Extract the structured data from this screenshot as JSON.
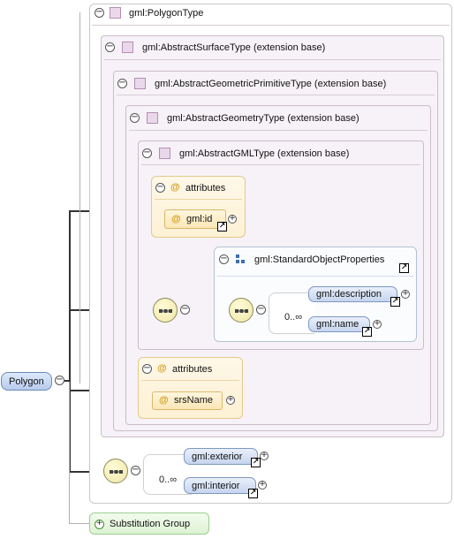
{
  "diagram": {
    "root_element": "Polygon",
    "types": {
      "polygon_type": "gml:PolygonType",
      "abstract_surface_type": "gml:AbstractSurfaceType (extension base)",
      "abstract_geometric_primitive_type": "gml:AbstractGeometricPrimitiveType (extension base)",
      "abstract_geometry_type": "gml:AbstractGeometryType (extension base)",
      "abstract_gml_type": "gml:AbstractGMLType (extension base)"
    },
    "gml_attributes": {
      "label": "attributes",
      "items": [
        "gml:id"
      ]
    },
    "standard_object_properties": {
      "label": "gml:StandardObjectProperties",
      "elements": [
        "gml:description",
        "gml:name"
      ],
      "cardinality": "0..∞"
    },
    "geometry_attributes": {
      "label": "attributes",
      "items": [
        "srsName"
      ]
    },
    "polygon_sequence": {
      "elements": [
        "gml:exterior",
        "gml:interior"
      ],
      "cardinality": "0..∞"
    },
    "substitution_group": "Substitution Group",
    "icons": {
      "collapse": "−",
      "expand": "+",
      "attribute": "@",
      "link": "↗"
    },
    "colors": {
      "type_box": "#f7f2f7",
      "attribute_box": "#fdf1d5",
      "element_box": "#c6d5ee",
      "substitution_box": "#dcf2d2"
    }
  }
}
